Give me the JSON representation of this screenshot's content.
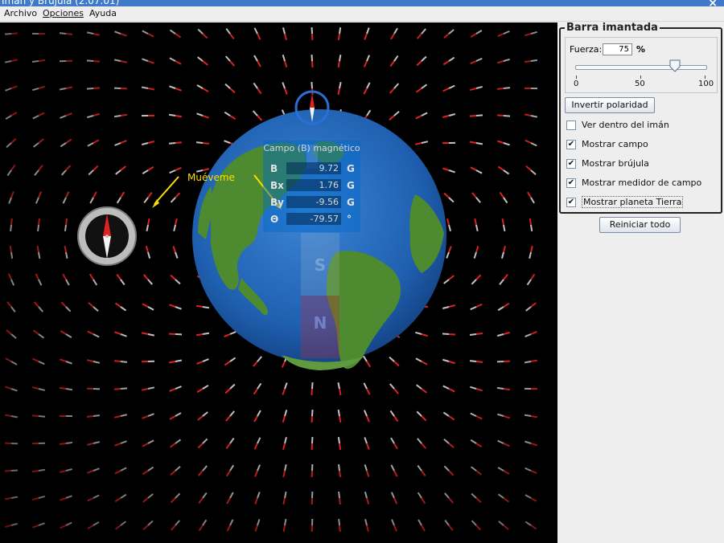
{
  "window": {
    "title": "Imán y Brújula (2.07.01)",
    "close_glyph": "×"
  },
  "menubar": {
    "items": [
      {
        "label": "Archivo"
      },
      {
        "label": "Opciones"
      },
      {
        "label": "Ayuda"
      }
    ]
  },
  "canvas": {
    "hint": "Muéveme",
    "magnet": {
      "pole_n": "N",
      "pole_s": "S"
    }
  },
  "field_meter": {
    "title": "Campo (B) magnético",
    "rows": [
      {
        "label": "B",
        "value": "9.72",
        "unit": "G"
      },
      {
        "label": "Bx",
        "value": "1.76",
        "unit": "G"
      },
      {
        "label": "By",
        "value": "-9.56",
        "unit": "G"
      },
      {
        "label": "Θ",
        "value": "-79.57",
        "unit": "°"
      }
    ]
  },
  "panel": {
    "group_title": "Barra imantada",
    "strength": {
      "label": "Fuerza:",
      "value": "75",
      "unit": "%",
      "slider_value": 0.75,
      "ticks": [
        "0",
        "50",
        "100"
      ]
    },
    "flip_button": "Invertir polaridad",
    "checkboxes": [
      {
        "label": "Ver dentro del imán",
        "checked": false
      },
      {
        "label": "Mostrar campo",
        "checked": true
      },
      {
        "label": "Mostrar brújula",
        "checked": true
      },
      {
        "label": "Mostrar medidor de campo",
        "checked": true
      },
      {
        "label": "Mostrar planeta Tierra",
        "checked": true
      }
    ],
    "check_glyph": "✔",
    "reset_button": "Reiniciar todo"
  },
  "colors": {
    "titlebar": "#3f79c9",
    "background": "#000000",
    "ocean": "#1f5fb0",
    "land": "#4e8a30",
    "hint": "#ffdd00",
    "needle_north": "#dd2222",
    "needle_south": "#f4f4f4"
  }
}
